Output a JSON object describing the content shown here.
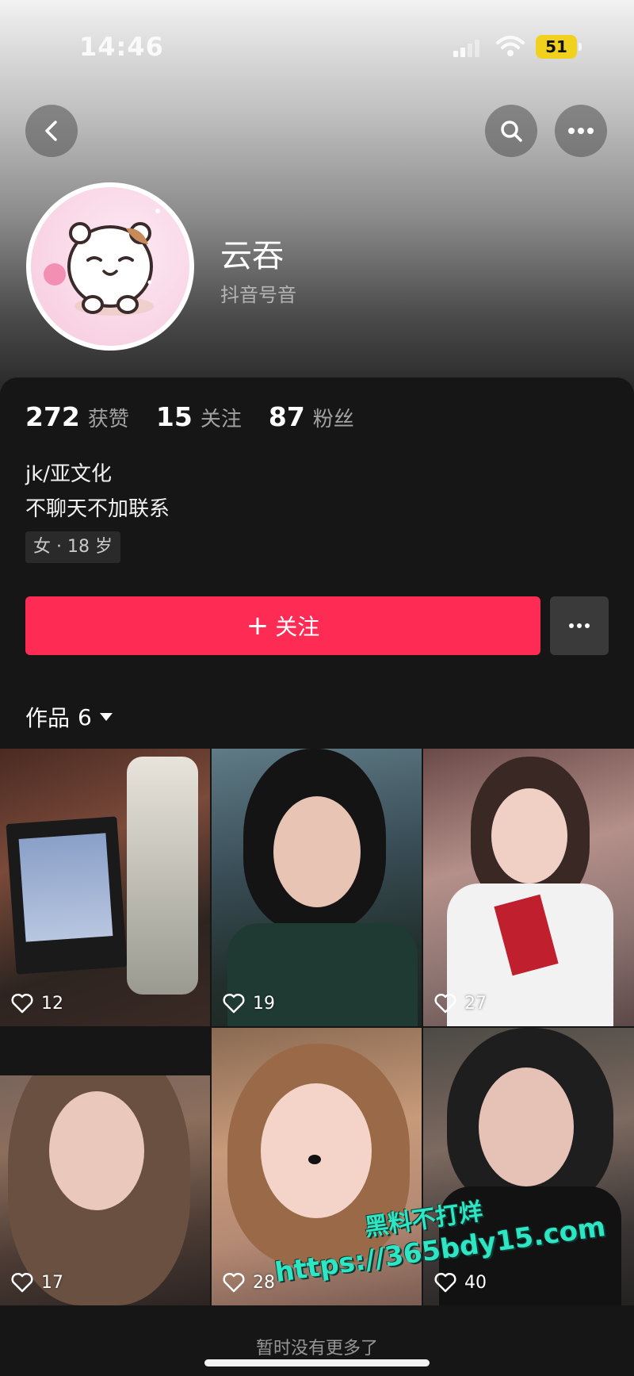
{
  "status_bar": {
    "time": "14:46",
    "battery": "51"
  },
  "profile": {
    "nickname": "云吞",
    "douyin_id": "抖音号音",
    "stats": [
      {
        "value": "272",
        "label": "获赞"
      },
      {
        "value": "15",
        "label": "关注"
      },
      {
        "value": "87",
        "label": "粉丝"
      }
    ],
    "bio_lines": [
      "jk/亚文化",
      "不聊天不加联系"
    ],
    "tag": "女 · 18 岁"
  },
  "actions": {
    "follow_label": "关注",
    "follow_plus": "+"
  },
  "works": {
    "label": "作品",
    "count": "6",
    "items": [
      {
        "likes": "12"
      },
      {
        "likes": "19"
      },
      {
        "likes": "27"
      },
      {
        "likes": "17"
      },
      {
        "likes": "28"
      },
      {
        "likes": "40"
      }
    ]
  },
  "footer": {
    "no_more": "暂时没有更多了"
  },
  "watermark": {
    "line1": "黑料不打烊",
    "line2": "https://365bdy15.com"
  },
  "colors": {
    "follow_button": "#fe2c55",
    "panel": "#161616",
    "battery": "#f0d21e",
    "watermark": "#2ee6c4"
  }
}
